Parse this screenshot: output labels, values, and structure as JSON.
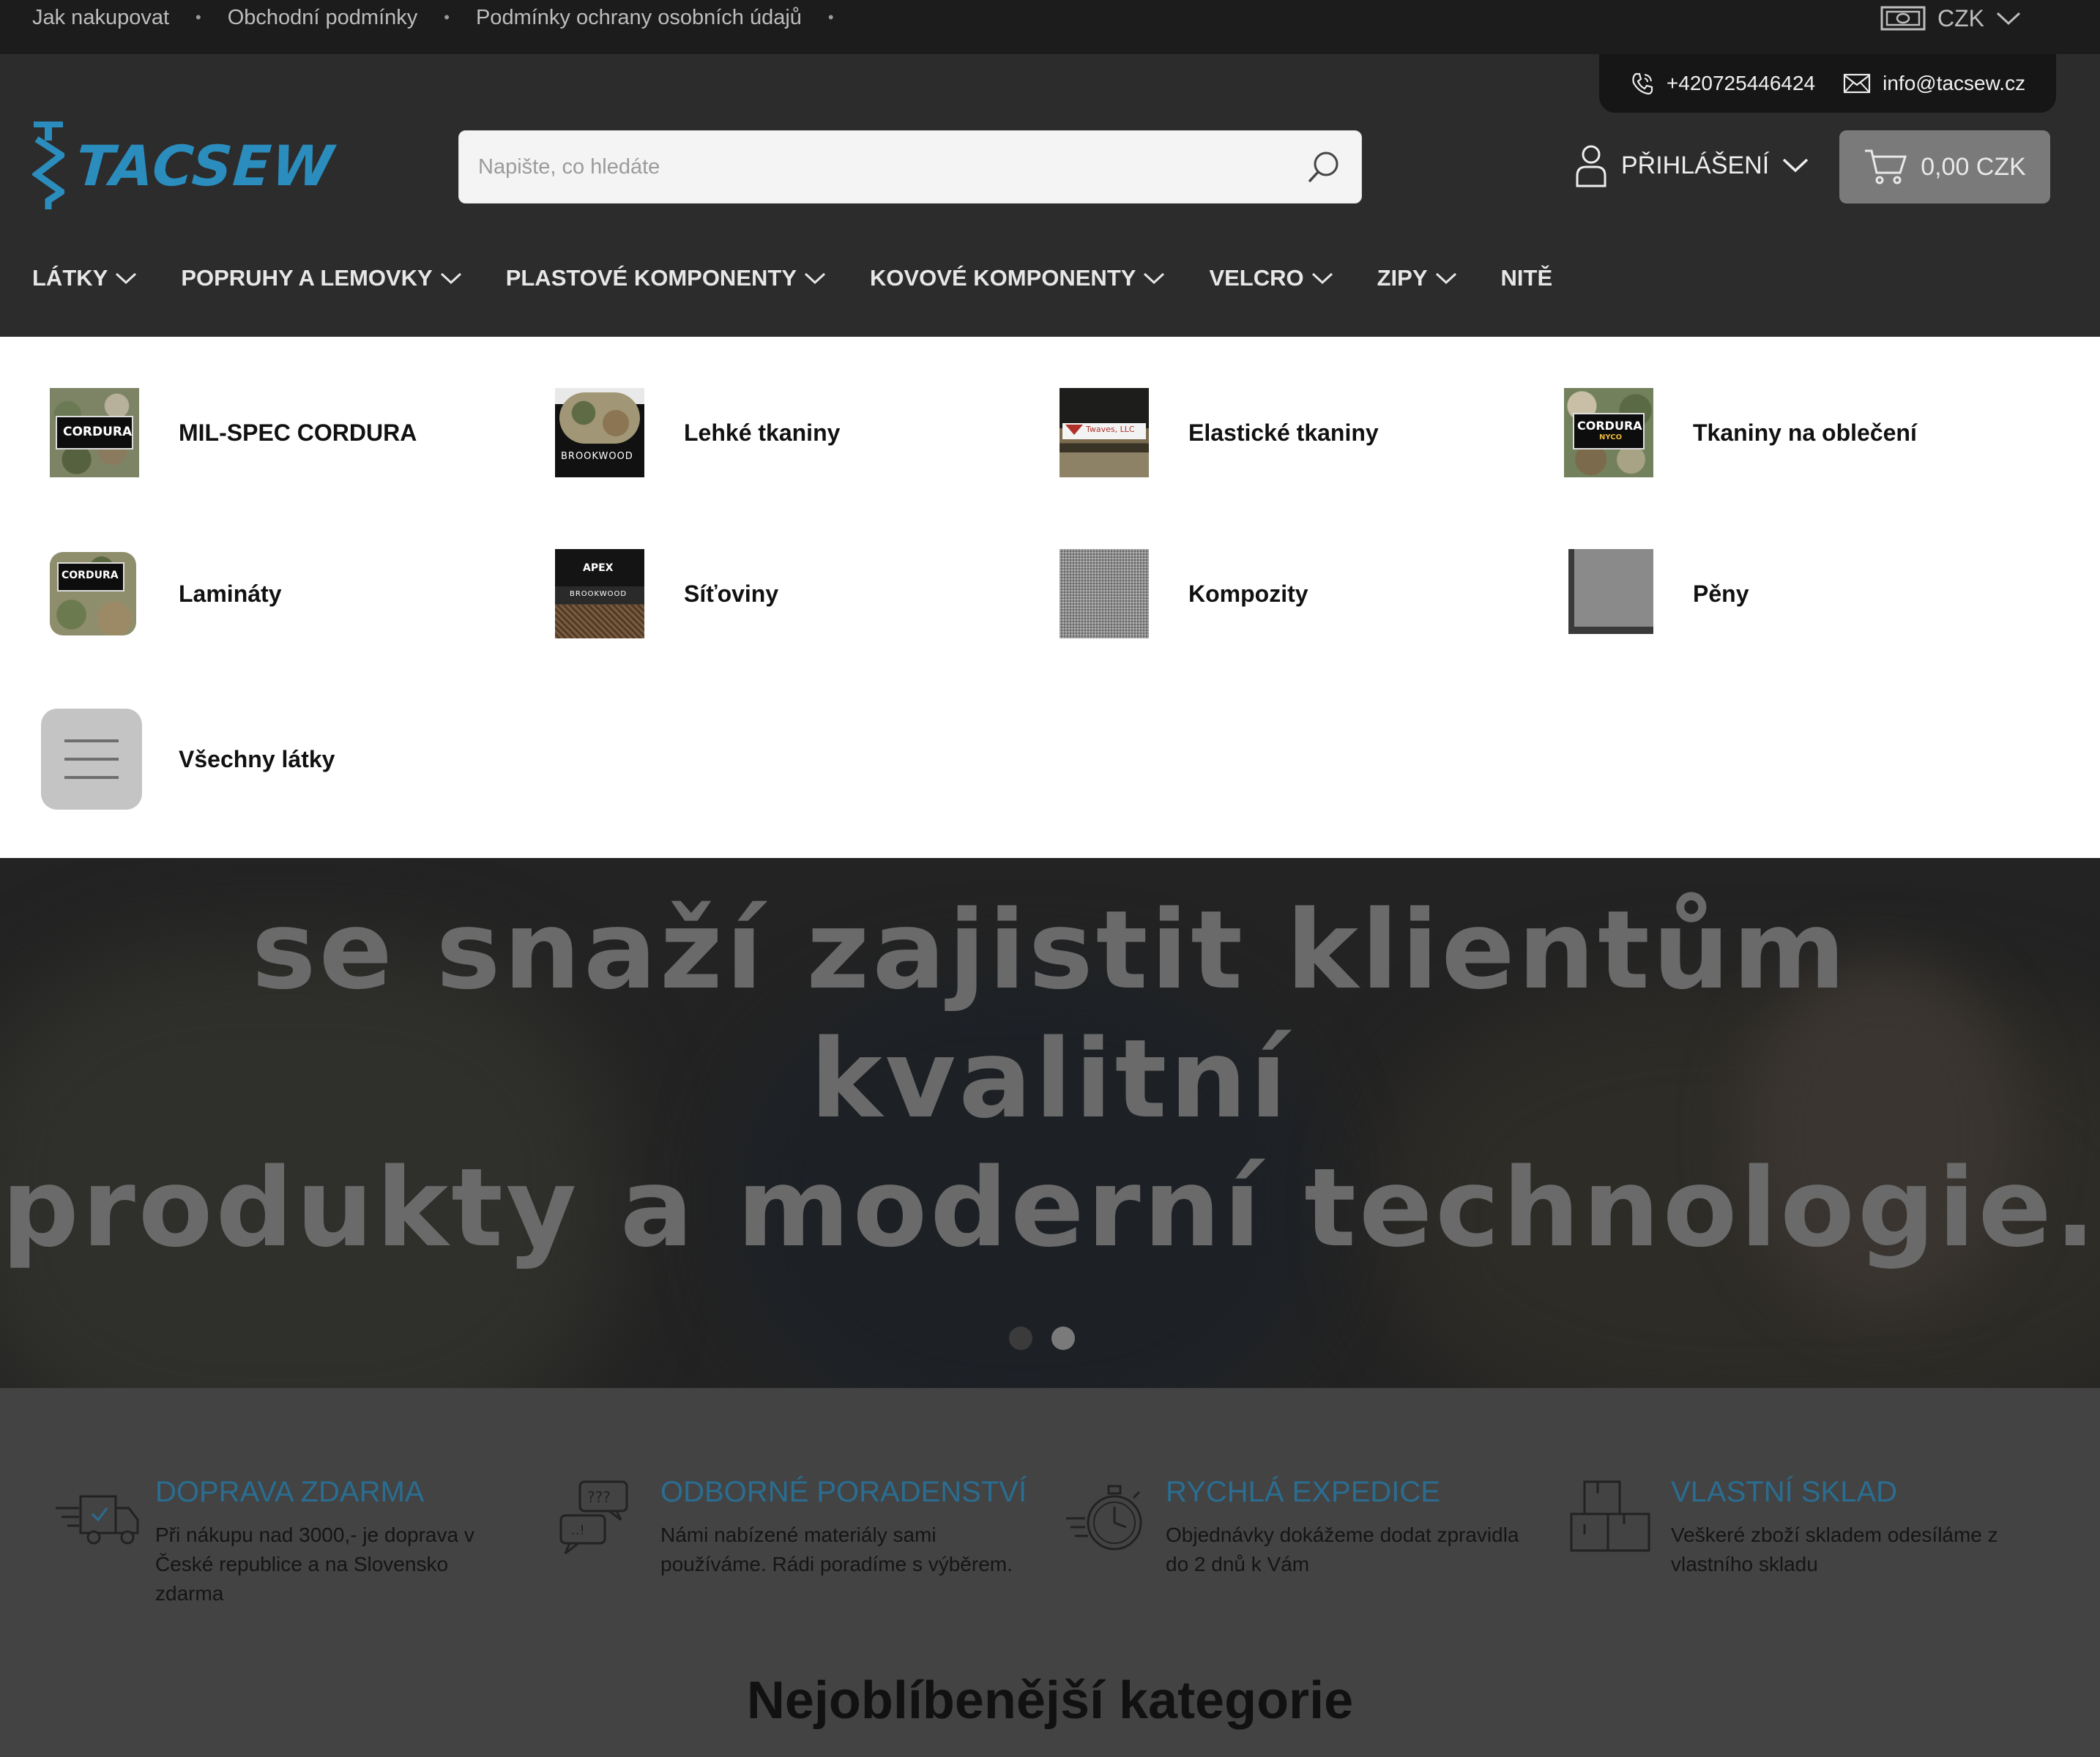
{
  "topbar": {
    "links": [
      "Jak nakupovat",
      "Obchodní podmínky",
      "Podmínky ochrany osobních údajů"
    ],
    "currency": "CZK"
  },
  "contact": {
    "phone": "+420725446424",
    "email": "info@tacsew.cz"
  },
  "logo": {
    "text": "TACSEW"
  },
  "search": {
    "placeholder": "Napište, co hledáte"
  },
  "account": {
    "login_label": "PŘIHLÁŠENÍ"
  },
  "cart": {
    "total": "0,00 CZK"
  },
  "nav": {
    "items": [
      "LÁTKY",
      "POPRUHY A LEMOVKY",
      "PLASTOVÉ KOMPONENTY",
      "KOVOVÉ KOMPONENTY",
      "VELCRO",
      "ZIPY",
      "NITĚ"
    ]
  },
  "mega_menu": {
    "items": [
      {
        "label": "MIL-SPEC CORDURA"
      },
      {
        "label": "Lehké tkaniny"
      },
      {
        "label": "Elastické tkaniny"
      },
      {
        "label": "Tkaniny na oblečení"
      },
      {
        "label": "Lamináty"
      },
      {
        "label": "Síťoviny"
      },
      {
        "label": "Kompozity"
      },
      {
        "label": "Pěny"
      },
      {
        "label": "Všechny látky"
      }
    ],
    "thumb_brands": {
      "cordura": "CORDURA",
      "brookwood": "BROOKWOOD",
      "apex": "APEX",
      "twaves": "Twaves, LLC",
      "nyco": "NYCO"
    }
  },
  "hero": {
    "line1": "se snaží zajistit klientům kvalitní",
    "line2": "produkty a moderní technologie.",
    "slide_count": 2,
    "active_slide": 2
  },
  "benefits": [
    {
      "title": "DOPRAVA ZDARMA",
      "text": "Při nákupu nad 3000,- je doprava v České republice a na Slovensko zdarma",
      "icon": "delivery-truck-icon"
    },
    {
      "title": "ODBORNÉ PORADENSTVÍ",
      "text": "Námi nabízené materiály sami používáme. Rádi poradíme s výběrem.",
      "icon": "chat-bubbles-icon"
    },
    {
      "title": "RYCHLÁ EXPEDICE",
      "text": "Objednávky dokážeme dodat zpravidla do 2 dnů k Vám",
      "icon": "stopwatch-icon"
    },
    {
      "title": "VLASTNÍ SKLAD",
      "text": "Veškeré zboží skladem odesíláme z vlastního skladu",
      "icon": "boxes-icon"
    }
  ],
  "section": {
    "popular_title": "Nejoblíbenější kategorie"
  },
  "colors": {
    "accent": "#2a8dbd",
    "benefit_title": "#2a6d90",
    "header_bg": "#2c2c2c",
    "topbar_bg": "#1c1c1c"
  }
}
